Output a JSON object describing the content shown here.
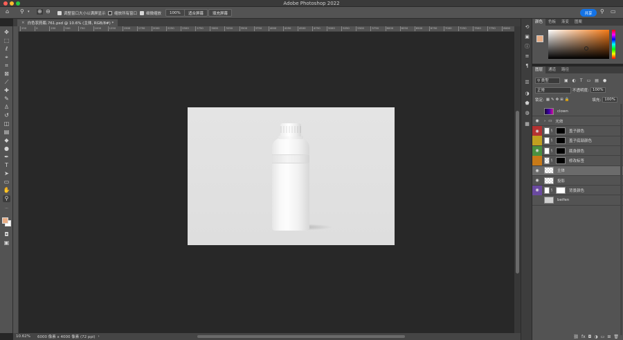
{
  "app": {
    "title": "Adobe Photoshop 2022"
  },
  "options_bar": {
    "resize_windows_label": "调整窗口大小以满屏显示",
    "zoom_all_label": "缩放所有窗口",
    "scrubby_zoom_label": "细微缩放",
    "zoom_percent": "100%",
    "fit_screen_label": "适合屏幕",
    "fill_screen_label": "填充屏幕",
    "share_label": "共享"
  },
  "document": {
    "tab_title": "白色农药瓶.761.psd @ 10.6% (主体, RGB/8#) *"
  },
  "ruler_ticks": [
    "250",
    "0",
    "250",
    "500",
    "750",
    "1000",
    "1250",
    "1500",
    "1750",
    "2000",
    "2250",
    "2500",
    "2750",
    "3000",
    "3250",
    "3500",
    "3750",
    "4000",
    "4250",
    "4500",
    "4750",
    "5000",
    "5250",
    "5500",
    "5750",
    "6000",
    "6250",
    "6500",
    "6750",
    "7000",
    "7250",
    "7500",
    "7750",
    "8000"
  ],
  "status_bar": {
    "zoom": "10.62%",
    "doc_size": "6000 像素 x 4000 像素 (72 ppi)"
  },
  "color_panel": {
    "tabs": [
      "颜色",
      "色板",
      "渐变",
      "图案"
    ],
    "foreground": "#e8ad85",
    "background": "#ffffff"
  },
  "layers_panel": {
    "tabs": [
      "图层",
      "通道",
      "路径"
    ],
    "filter_kind": "类型",
    "blend_mode": "正常",
    "opacity_label": "不透明度:",
    "opacity_value": "100%",
    "lock_label": "锁定:",
    "fill_label": "填充:",
    "fill_value": "100%",
    "layers": [
      {
        "name": "clown",
        "thumb": "clown",
        "visible": false,
        "color": ""
      },
      {
        "name": "光效",
        "thumb": "folder",
        "visible": true,
        "color": ""
      },
      {
        "name": "盖子颜色",
        "thumb": "black",
        "visible": true,
        "color": "#b33232"
      },
      {
        "name": "盖子底部颜色",
        "thumb": "black",
        "visible": false,
        "color": "#c0a020"
      },
      {
        "name": "瓶身颜色",
        "thumb": "black",
        "visible": true,
        "color": "#4a9040"
      },
      {
        "name": "修改标签",
        "thumb": "black",
        "visible": false,
        "color": "#c87a18"
      },
      {
        "name": "主体",
        "thumb": "checker",
        "visible": true,
        "color": ""
      },
      {
        "name": "投影",
        "thumb": "checker",
        "visible": true,
        "color": ""
      },
      {
        "name": "背景颜色",
        "thumb": "white",
        "visible": true,
        "color": "#6a4aa0"
      },
      {
        "name": "beifen",
        "thumb": "gray",
        "visible": false,
        "color": ""
      }
    ]
  }
}
